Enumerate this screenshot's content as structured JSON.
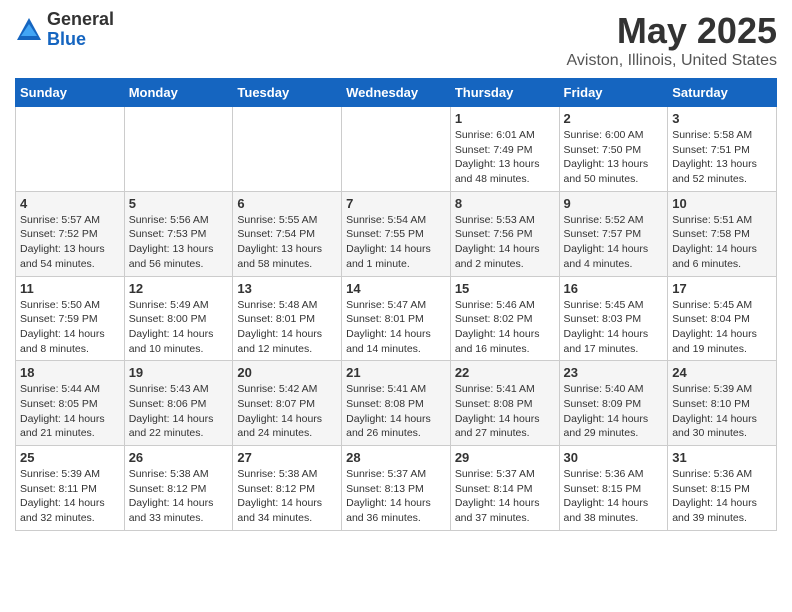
{
  "logo": {
    "general": "General",
    "blue": "Blue"
  },
  "title": "May 2025",
  "location": "Aviston, Illinois, United States",
  "weekdays": [
    "Sunday",
    "Monday",
    "Tuesday",
    "Wednesday",
    "Thursday",
    "Friday",
    "Saturday"
  ],
  "weeks": [
    [
      {
        "day": "",
        "sunrise": "",
        "sunset": "",
        "daylight": ""
      },
      {
        "day": "",
        "sunrise": "",
        "sunset": "",
        "daylight": ""
      },
      {
        "day": "",
        "sunrise": "",
        "sunset": "",
        "daylight": ""
      },
      {
        "day": "",
        "sunrise": "",
        "sunset": "",
        "daylight": ""
      },
      {
        "day": "1",
        "sunrise": "Sunrise: 6:01 AM",
        "sunset": "Sunset: 7:49 PM",
        "daylight": "Daylight: 13 hours and 48 minutes."
      },
      {
        "day": "2",
        "sunrise": "Sunrise: 6:00 AM",
        "sunset": "Sunset: 7:50 PM",
        "daylight": "Daylight: 13 hours and 50 minutes."
      },
      {
        "day": "3",
        "sunrise": "Sunrise: 5:58 AM",
        "sunset": "Sunset: 7:51 PM",
        "daylight": "Daylight: 13 hours and 52 minutes."
      }
    ],
    [
      {
        "day": "4",
        "sunrise": "Sunrise: 5:57 AM",
        "sunset": "Sunset: 7:52 PM",
        "daylight": "Daylight: 13 hours and 54 minutes."
      },
      {
        "day": "5",
        "sunrise": "Sunrise: 5:56 AM",
        "sunset": "Sunset: 7:53 PM",
        "daylight": "Daylight: 13 hours and 56 minutes."
      },
      {
        "day": "6",
        "sunrise": "Sunrise: 5:55 AM",
        "sunset": "Sunset: 7:54 PM",
        "daylight": "Daylight: 13 hours and 58 minutes."
      },
      {
        "day": "7",
        "sunrise": "Sunrise: 5:54 AM",
        "sunset": "Sunset: 7:55 PM",
        "daylight": "Daylight: 14 hours and 1 minute."
      },
      {
        "day": "8",
        "sunrise": "Sunrise: 5:53 AM",
        "sunset": "Sunset: 7:56 PM",
        "daylight": "Daylight: 14 hours and 2 minutes."
      },
      {
        "day": "9",
        "sunrise": "Sunrise: 5:52 AM",
        "sunset": "Sunset: 7:57 PM",
        "daylight": "Daylight: 14 hours and 4 minutes."
      },
      {
        "day": "10",
        "sunrise": "Sunrise: 5:51 AM",
        "sunset": "Sunset: 7:58 PM",
        "daylight": "Daylight: 14 hours and 6 minutes."
      }
    ],
    [
      {
        "day": "11",
        "sunrise": "Sunrise: 5:50 AM",
        "sunset": "Sunset: 7:59 PM",
        "daylight": "Daylight: 14 hours and 8 minutes."
      },
      {
        "day": "12",
        "sunrise": "Sunrise: 5:49 AM",
        "sunset": "Sunset: 8:00 PM",
        "daylight": "Daylight: 14 hours and 10 minutes."
      },
      {
        "day": "13",
        "sunrise": "Sunrise: 5:48 AM",
        "sunset": "Sunset: 8:01 PM",
        "daylight": "Daylight: 14 hours and 12 minutes."
      },
      {
        "day": "14",
        "sunrise": "Sunrise: 5:47 AM",
        "sunset": "Sunset: 8:01 PM",
        "daylight": "Daylight: 14 hours and 14 minutes."
      },
      {
        "day": "15",
        "sunrise": "Sunrise: 5:46 AM",
        "sunset": "Sunset: 8:02 PM",
        "daylight": "Daylight: 14 hours and 16 minutes."
      },
      {
        "day": "16",
        "sunrise": "Sunrise: 5:45 AM",
        "sunset": "Sunset: 8:03 PM",
        "daylight": "Daylight: 14 hours and 17 minutes."
      },
      {
        "day": "17",
        "sunrise": "Sunrise: 5:45 AM",
        "sunset": "Sunset: 8:04 PM",
        "daylight": "Daylight: 14 hours and 19 minutes."
      }
    ],
    [
      {
        "day": "18",
        "sunrise": "Sunrise: 5:44 AM",
        "sunset": "Sunset: 8:05 PM",
        "daylight": "Daylight: 14 hours and 21 minutes."
      },
      {
        "day": "19",
        "sunrise": "Sunrise: 5:43 AM",
        "sunset": "Sunset: 8:06 PM",
        "daylight": "Daylight: 14 hours and 22 minutes."
      },
      {
        "day": "20",
        "sunrise": "Sunrise: 5:42 AM",
        "sunset": "Sunset: 8:07 PM",
        "daylight": "Daylight: 14 hours and 24 minutes."
      },
      {
        "day": "21",
        "sunrise": "Sunrise: 5:41 AM",
        "sunset": "Sunset: 8:08 PM",
        "daylight": "Daylight: 14 hours and 26 minutes."
      },
      {
        "day": "22",
        "sunrise": "Sunrise: 5:41 AM",
        "sunset": "Sunset: 8:08 PM",
        "daylight": "Daylight: 14 hours and 27 minutes."
      },
      {
        "day": "23",
        "sunrise": "Sunrise: 5:40 AM",
        "sunset": "Sunset: 8:09 PM",
        "daylight": "Daylight: 14 hours and 29 minutes."
      },
      {
        "day": "24",
        "sunrise": "Sunrise: 5:39 AM",
        "sunset": "Sunset: 8:10 PM",
        "daylight": "Daylight: 14 hours and 30 minutes."
      }
    ],
    [
      {
        "day": "25",
        "sunrise": "Sunrise: 5:39 AM",
        "sunset": "Sunset: 8:11 PM",
        "daylight": "Daylight: 14 hours and 32 minutes."
      },
      {
        "day": "26",
        "sunrise": "Sunrise: 5:38 AM",
        "sunset": "Sunset: 8:12 PM",
        "daylight": "Daylight: 14 hours and 33 minutes."
      },
      {
        "day": "27",
        "sunrise": "Sunrise: 5:38 AM",
        "sunset": "Sunset: 8:12 PM",
        "daylight": "Daylight: 14 hours and 34 minutes."
      },
      {
        "day": "28",
        "sunrise": "Sunrise: 5:37 AM",
        "sunset": "Sunset: 8:13 PM",
        "daylight": "Daylight: 14 hours and 36 minutes."
      },
      {
        "day": "29",
        "sunrise": "Sunrise: 5:37 AM",
        "sunset": "Sunset: 8:14 PM",
        "daylight": "Daylight: 14 hours and 37 minutes."
      },
      {
        "day": "30",
        "sunrise": "Sunrise: 5:36 AM",
        "sunset": "Sunset: 8:15 PM",
        "daylight": "Daylight: 14 hours and 38 minutes."
      },
      {
        "day": "31",
        "sunrise": "Sunrise: 5:36 AM",
        "sunset": "Sunset: 8:15 PM",
        "daylight": "Daylight: 14 hours and 39 minutes."
      }
    ]
  ]
}
